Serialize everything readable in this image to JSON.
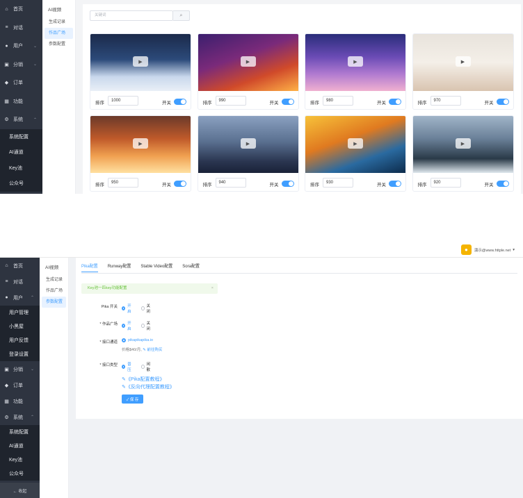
{
  "top": {
    "sidebar": {
      "items": [
        {
          "icon": "home-icon",
          "glyph": "⌂",
          "label": "首页"
        },
        {
          "icon": "chat-icon",
          "glyph": "≡",
          "label": "对话"
        },
        {
          "icon": "user-icon",
          "glyph": "●",
          "label": "用户",
          "chevron": "⌄"
        },
        {
          "icon": "share-icon",
          "glyph": "▣",
          "label": "分销",
          "chevron": "⌄"
        },
        {
          "icon": "order-icon",
          "glyph": "◆",
          "label": "订单"
        },
        {
          "icon": "feature-icon",
          "glyph": "▦",
          "label": "功能"
        },
        {
          "icon": "settings-icon",
          "glyph": "⚙",
          "label": "系统",
          "chevron": "⌃"
        }
      ],
      "sub_items": [
        "系统配置",
        "AI通道",
        "Key池",
        "公众号"
      ]
    },
    "subnav": {
      "title": "AI视频",
      "items": [
        "生成记录",
        "作品广场",
        "参数配置"
      ],
      "active_index": 1
    },
    "search": {
      "placeholder": "关键词",
      "icon": "search-icon"
    },
    "sort_label": "排序",
    "switch_label": "开关",
    "cards": [
      {
        "sort": "1000",
        "on": true
      },
      {
        "sort": "990",
        "on": true
      },
      {
        "sort": "980",
        "on": true
      },
      {
        "sort": "970",
        "on": true
      },
      {
        "sort": "950",
        "on": true
      },
      {
        "sort": "940",
        "on": true
      },
      {
        "sort": "930",
        "on": true
      },
      {
        "sort": "920",
        "on": true
      }
    ]
  },
  "bottom": {
    "user": {
      "name": "演示@www.httple.net",
      "chevron": "▾"
    },
    "sidebar": {
      "items_before": [
        {
          "icon": "home-icon",
          "glyph": "⌂",
          "label": "首页"
        },
        {
          "icon": "chat-icon",
          "glyph": "≡",
          "label": "对话"
        },
        {
          "icon": "user-icon",
          "glyph": "●",
          "label": "用户",
          "chevron": "⌃"
        }
      ],
      "user_sub": [
        "用户管理",
        "小黑屋",
        "用户反馈",
        "登录设置"
      ],
      "items_after": [
        {
          "icon": "share-icon",
          "glyph": "▣",
          "label": "分销",
          "chevron": "⌄"
        },
        {
          "icon": "order-icon",
          "glyph": "◆",
          "label": "订单"
        },
        {
          "icon": "feature-icon",
          "glyph": "▦",
          "label": "功能"
        },
        {
          "icon": "settings-icon",
          "glyph": "⚙",
          "label": "系统",
          "chevron": "⌃"
        }
      ],
      "sys_sub": [
        "系统配置",
        "AI通道",
        "Key池",
        "公众号"
      ],
      "collapse_label": "← 收起"
    },
    "subnav": {
      "title": "AI视频",
      "items": [
        "生成记录",
        "作品广场",
        "参数配置"
      ],
      "active_index": 2
    },
    "tabs": [
      "Pika配置",
      "Runway配置",
      "Stable Video配置",
      "Sora配置"
    ],
    "active_tab": 0,
    "alert": {
      "text": "Key池一匹key功能配置",
      "close": "×"
    },
    "form": {
      "pika_switch": {
        "label": "Pika 开关",
        "on": "开启",
        "off": "关闭"
      },
      "gallery": {
        "label": "* 作品广场",
        "on": "开启",
        "off": "关闭"
      },
      "channel": {
        "label": "* 接口通道",
        "value": "pikapikapika.io",
        "price_text": "价格$40/月,",
        "buy_link": "✎ 前往购买"
      },
      "interface_type": {
        "label": "* 接口类型",
        "opt1": "普压",
        "opt2": "闲散"
      },
      "links": [
        "✎《Pika配置教程》",
        "✎《反向代理配置教程》"
      ],
      "save_label": "✓ 保 存"
    }
  }
}
